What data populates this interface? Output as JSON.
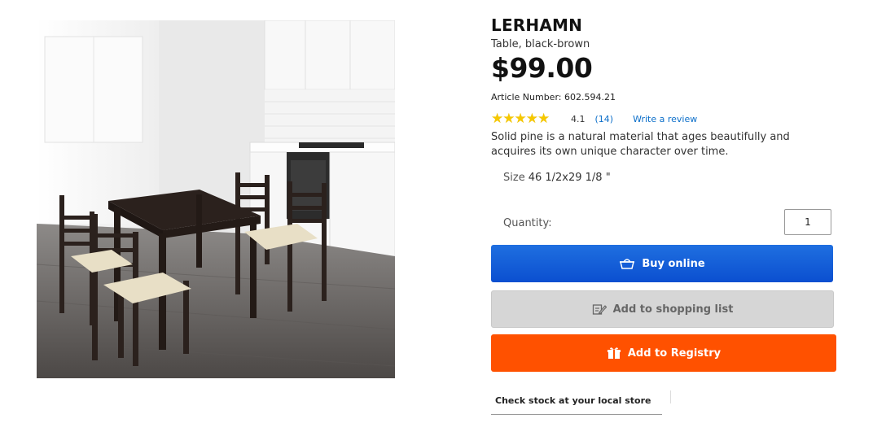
{
  "product": {
    "name": "LERHAMN",
    "subtitle": "Table, black-brown",
    "price": "$99.00",
    "article_number": "Article Number: 602.594.21",
    "rating": {
      "score": 4.1,
      "score_text": "4.1",
      "count_text": "(14)",
      "write_review": "Write a review",
      "star_color": "#f6c800"
    },
    "description": "Solid pine is a natural material that ages beautifully and acquires its own unique character over time.",
    "size": {
      "label": "Size",
      "value": "46 1/2x29 1/8 \""
    },
    "quantity": {
      "label": "Quantity:",
      "value": "1"
    }
  },
  "buttons": {
    "buy_online": {
      "label": "Buy online",
      "icon": "basket-icon",
      "color": "#0b57d0"
    },
    "shopping_list": {
      "label": "Add to shopping list",
      "icon": "pencil-list-icon",
      "color": "#d6d6d6"
    },
    "registry": {
      "label": "Add to Registry",
      "icon": "gift-icon",
      "color": "#ff5100"
    }
  },
  "stock": {
    "label": "Check stock at your local store"
  }
}
